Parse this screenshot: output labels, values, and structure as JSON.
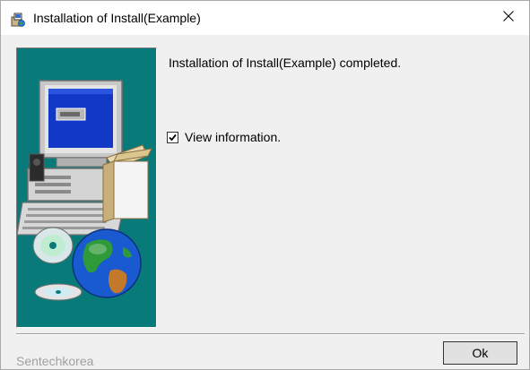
{
  "window": {
    "title": "Installation of Install(Example)",
    "close_glyph": "✕"
  },
  "main": {
    "message": "Installation of Install(Example) completed.",
    "view_info": {
      "label": "View information.",
      "checked": true
    },
    "illustration": {
      "description_icons": [
        "computer-icon",
        "globe-icon",
        "cd-disc-icon"
      ],
      "background_color": "#097a7a"
    }
  },
  "footer": {
    "brand": "Sentechkorea",
    "ok_label": "Ok"
  }
}
